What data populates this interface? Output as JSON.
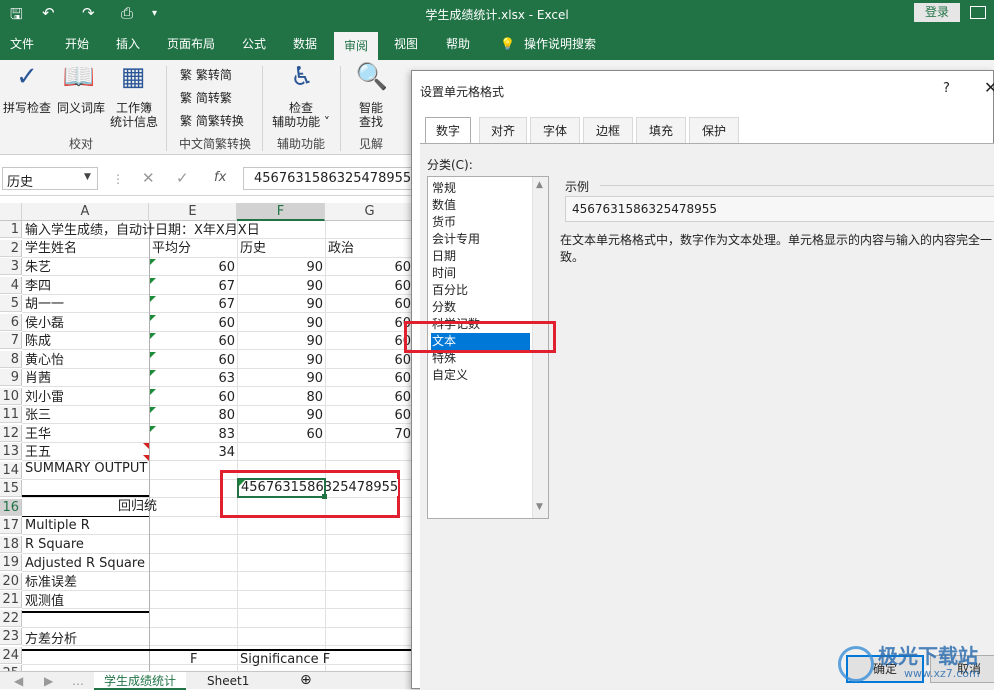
{
  "titlebar": {
    "doc_title": "学生成绩统计.xlsx  -  Excel",
    "login": "登录"
  },
  "ribbon_tabs": [
    "文件",
    "开始",
    "插入",
    "页面布局",
    "公式",
    "数据",
    "审阅",
    "视图",
    "帮助"
  ],
  "ribbon_search": "操作说明搜索",
  "ribbon": {
    "spell": "拼写检查",
    "thesaurus": "同义词库",
    "stats1": "工作簿",
    "stats2": "统计信息",
    "group_proof": "校对",
    "trad": "繁转简",
    "simp": "简转繁",
    "conv": "简繁转换",
    "group_chinese": "中文简繁转换",
    "check1": "检查",
    "check2": "辅助功能",
    "group_access": "辅助功能",
    "smart1": "智能",
    "smart2": "查找",
    "group_insight": "见解"
  },
  "formula_bar": {
    "name_box": "历史",
    "formula": "4567631586325478955"
  },
  "columns": [
    "A",
    "E",
    "F",
    "G"
  ],
  "rows": [
    "1",
    "2",
    "3",
    "4",
    "5",
    "6",
    "7",
    "8",
    "9",
    "10",
    "11",
    "12",
    "13",
    "14",
    "15",
    "16",
    "17",
    "18",
    "19",
    "20",
    "21",
    "22",
    "23",
    "24",
    "25"
  ],
  "sheet": {
    "r1": "输入学生成绩，自动计日期：X年X月X日",
    "header": {
      "name": "学生姓名",
      "avg": "平均分",
      "hist": "历史",
      "pol": "政治"
    },
    "students": [
      {
        "name": "朱艺",
        "avg": "60",
        "hist": "90",
        "pol": "60"
      },
      {
        "name": "李四",
        "avg": "67",
        "hist": "90",
        "pol": "60"
      },
      {
        "name": "胡一一",
        "avg": "67",
        "hist": "90",
        "pol": "60"
      },
      {
        "name": "侯小磊",
        "avg": "60",
        "hist": "90",
        "pol": "60"
      },
      {
        "name": "陈成",
        "avg": "60",
        "hist": "90",
        "pol": "60"
      },
      {
        "name": "黄心怡",
        "avg": "60",
        "hist": "90",
        "pol": "60"
      },
      {
        "name": "肖茜",
        "avg": "63",
        "hist": "90",
        "pol": "60"
      },
      {
        "name": "刘小雷",
        "avg": "60",
        "hist": "80",
        "pol": "60"
      },
      {
        "name": "张三",
        "avg": "80",
        "hist": "90",
        "pol": "60"
      },
      {
        "name": "王华",
        "avg": "83",
        "hist": "60",
        "pol": "70"
      },
      {
        "name": "王五",
        "avg": "34",
        "hist": "",
        "pol": ""
      }
    ],
    "r15": "SUMMARY OUTPUT",
    "r16_value": "4567631586325478955",
    "r17": "回归统",
    "r18": "Multiple R",
    "r19": "R Square",
    "r20": "Adjusted R Square",
    "r21": "标准误差",
    "r22": "观测值",
    "r24": "方差分析",
    "r25_e": "F",
    "r25_f": "Significance F"
  },
  "sheet_tabs": [
    "学生成绩统计",
    "Sheet1"
  ],
  "dialog": {
    "title": "设置单元格格式",
    "help": "?",
    "close": "✕",
    "tabs": [
      "数字",
      "对齐",
      "字体",
      "边框",
      "填充",
      "保护"
    ],
    "category_label": "分类(C):",
    "categories": [
      "常规",
      "数值",
      "货币",
      "会计专用",
      "日期",
      "时间",
      "百分比",
      "分数",
      "科学记数",
      "文本",
      "特殊",
      "自定义"
    ],
    "selected_category": "文本",
    "sample_label": "示例",
    "sample_value": "4567631586325478955",
    "description": "在文本单元格格式中，数字作为文本处理。单元格显示的内容与输入的内容完全一致。",
    "ok": "确定",
    "cancel": "取消"
  },
  "watermark": {
    "line1": "极光下载站",
    "line2": "www.xz7.com"
  },
  "colors": {
    "excel_green": "#217346",
    "highlight_red": "#e0202e",
    "selection_blue": "#0078d7"
  }
}
